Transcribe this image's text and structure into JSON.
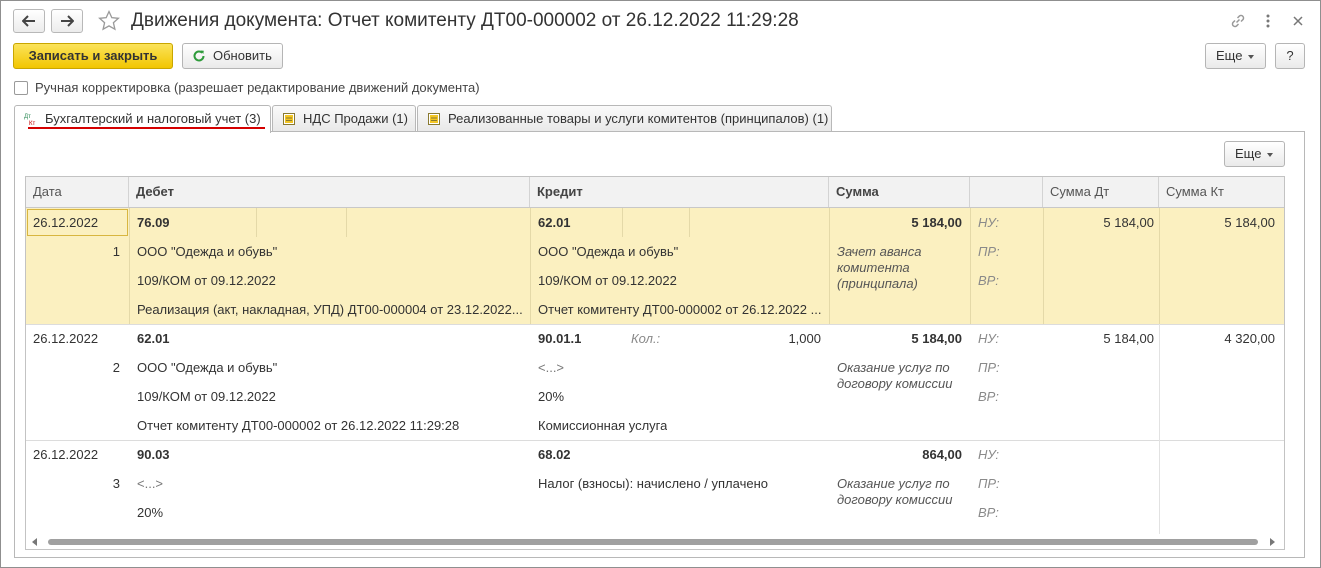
{
  "window": {
    "title": "Движения документа: Отчет комитенту ДТ00-000002 от 26.12.2022 11:29:28"
  },
  "toolbar": {
    "save_close_label": "Записать и закрыть",
    "refresh_label": "Обновить",
    "more_label": "Еще",
    "help_label": "?"
  },
  "manual_correction": {
    "label": "Ручная корректировка (разрешает редактирование движений документа)",
    "checked": false
  },
  "tabs": [
    {
      "label": "Бухгалтерский и налоговый учет (3)",
      "icon": "dt-kt-icon",
      "active": true
    },
    {
      "label": "НДС Продажи (1)",
      "icon": "register-icon",
      "active": false
    },
    {
      "label": "Реализованные товары и услуги комитентов (принципалов) (1)",
      "icon": "register-icon",
      "active": false
    }
  ],
  "panel": {
    "more_label": "Еще"
  },
  "table": {
    "columns": [
      "Дата",
      "Дебет",
      "Кредит",
      "Сумма",
      "",
      "Сумма Дт",
      "Сумма Кт"
    ],
    "rows": [
      {
        "date": "26.12.2022",
        "number": "1",
        "debit_account": "76.09",
        "debit_sub1": "ООО \"Одежда и обувь\"",
        "debit_sub2": "109/КОМ от 09.12.2022",
        "debit_sub3": "Реализация (акт, накладная, УПД) ДТ00-000004 от 23.12.2022...",
        "credit_account": "62.01",
        "credit_qty_label": "",
        "credit_qty": "",
        "credit_sub1": "ООО \"Одежда и обувь\"",
        "credit_sub2": "109/КОМ от 09.12.2022",
        "credit_sub3": "Отчет комитенту ДТ00-000002 от 26.12.2022 ...",
        "amount": "5 184,00",
        "content": "Зачет аванса\nкомитента\n(принципала)",
        "nu": "НУ:",
        "pr": "ПР:",
        "vr": "ВР:",
        "sum_dt": "5 184,00",
        "sum_kt": "5 184,00"
      },
      {
        "date": "26.12.2022",
        "number": "2",
        "debit_account": "62.01",
        "debit_sub1": "ООО \"Одежда и обувь\"",
        "debit_sub2": "109/КОМ от 09.12.2022",
        "debit_sub3": "Отчет комитенту ДТ00-000002 от 26.12.2022 11:29:28",
        "credit_account": "90.01.1",
        "credit_qty_label": "Кол.:",
        "credit_qty": "1,000",
        "credit_sub1": "<...>",
        "credit_sub2": "20%",
        "credit_sub3": "Комиссионная услуга",
        "amount": "5 184,00",
        "content": "Оказание услуг по\nдоговору комиссии",
        "nu": "НУ:",
        "pr": "ПР:",
        "vr": "ВР:",
        "sum_dt": "5 184,00",
        "sum_kt": "4 320,00"
      },
      {
        "date": "26.12.2022",
        "number": "3",
        "debit_account": "90.03",
        "debit_sub1": "<...>",
        "debit_sub2": "20%",
        "debit_sub3": "",
        "credit_account": "68.02",
        "credit_qty_label": "",
        "credit_qty": "",
        "credit_sub1": "Налог (взносы): начислено / уплачено",
        "credit_sub2": "",
        "credit_sub3": "",
        "amount": "864,00",
        "content": "Оказание услуг по\nдоговору комиссии",
        "nu": "НУ:",
        "pr": "ПР:",
        "vr": "ВР:",
        "sum_dt": "",
        "sum_kt": ""
      }
    ]
  },
  "colors": {
    "primary_button": "#f2c600",
    "selected_row": "#fbf0c0",
    "active_tab_underline": "#d40000"
  }
}
